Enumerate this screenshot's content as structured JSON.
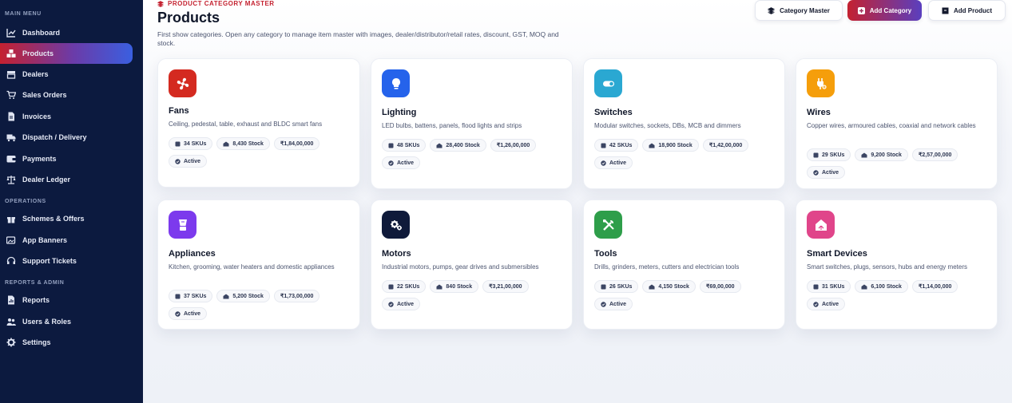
{
  "sidebar": {
    "sections": [
      {
        "label": "MAIN MENU"
      },
      {
        "label": "OPERATIONS"
      },
      {
        "label": "REPORTS & ADMIN"
      }
    ],
    "items": [
      {
        "label": "Dashboard",
        "icon": "chart-line-icon"
      },
      {
        "label": "Products",
        "icon": "boxes-icon",
        "active": true
      },
      {
        "label": "Dealers",
        "icon": "store-icon"
      },
      {
        "label": "Sales Orders",
        "icon": "cart-icon"
      },
      {
        "label": "Invoices",
        "icon": "invoice-icon"
      },
      {
        "label": "Dispatch / Delivery",
        "icon": "truck-icon"
      },
      {
        "label": "Payments",
        "icon": "wallet-icon"
      },
      {
        "label": "Dealer Ledger",
        "icon": "scale-icon"
      },
      {
        "label": "Schemes & Offers",
        "icon": "gift-icon"
      },
      {
        "label": "App Banners",
        "icon": "images-icon"
      },
      {
        "label": "Support Tickets",
        "icon": "headset-icon"
      },
      {
        "label": "Reports",
        "icon": "report-icon"
      },
      {
        "label": "Users & Roles",
        "icon": "users-icon"
      },
      {
        "label": "Settings",
        "icon": "gear-icon"
      }
    ]
  },
  "header": {
    "breadcrumb": "PRODUCT CATEGORY MASTER",
    "title": "Products",
    "description": "First show categories. Open any category to manage item master with images, dealer/distributor/retail rates, discount, GST, MOQ and stock.",
    "buttons": {
      "category_master": "Category Master",
      "add_category": "Add Category",
      "add_product": "Add Product"
    }
  },
  "categories": [
    {
      "name": "Fans",
      "description": "Ceiling, pedestal, table, exhaust and BLDC smart fans",
      "skus": "34 SKUs",
      "stock": "8,430 Stock",
      "value": "₹1,84,00,000",
      "status": "Active",
      "icon": "fan-icon",
      "color": "#d42a20"
    },
    {
      "name": "Lighting",
      "description": "LED bulbs, battens, panels, flood lights and strips",
      "skus": "48 SKUs",
      "stock": "28,400 Stock",
      "value": "₹1,26,00,000",
      "status": "Active",
      "icon": "bulb-icon",
      "color": "#2563eb"
    },
    {
      "name": "Switches",
      "description": "Modular switches, sockets, DBs, MCB and dimmers",
      "skus": "42 SKUs",
      "stock": "18,900 Stock",
      "value": "₹1,42,00,000",
      "status": "Active",
      "icon": "toggle-icon",
      "color": "#2aa8d2"
    },
    {
      "name": "Wires",
      "description": "Copper wires, armoured cables, coaxial and network cables",
      "skus": "29 SKUs",
      "stock": "9,200 Stock",
      "value": "₹2,57,00,000",
      "status": "Active",
      "icon": "plug-icon",
      "color": "#f59e0b"
    },
    {
      "name": "Appliances",
      "description": "Kitchen, grooming, water heaters and domestic appliances",
      "skus": "37 SKUs",
      "stock": "5,200 Stock",
      "value": "₹1,73,00,000",
      "status": "Active",
      "icon": "blender-icon",
      "color": "#7c3aed"
    },
    {
      "name": "Motors",
      "description": "Industrial motors, pumps, gear drives and submersibles",
      "skus": "22 SKUs",
      "stock": "840 Stock",
      "value": "₹3,21,00,000",
      "status": "Active",
      "icon": "cogs-icon",
      "color": "#0f1a3a"
    },
    {
      "name": "Tools",
      "description": "Drills, grinders, meters, cutters and electrician tools",
      "skus": "26 SKUs",
      "stock": "4,150 Stock",
      "value": "₹69,00,000",
      "status": "Active",
      "icon": "tools-icon",
      "color": "#2e9e4a"
    },
    {
      "name": "Smart Devices",
      "description": "Smart switches, plugs, sensors, hubs and energy meters",
      "skus": "31 SKUs",
      "stock": "6,100 Stock",
      "value": "₹1,14,00,000",
      "status": "Active",
      "icon": "smart-home-icon",
      "color": "#e0458a"
    }
  ]
}
